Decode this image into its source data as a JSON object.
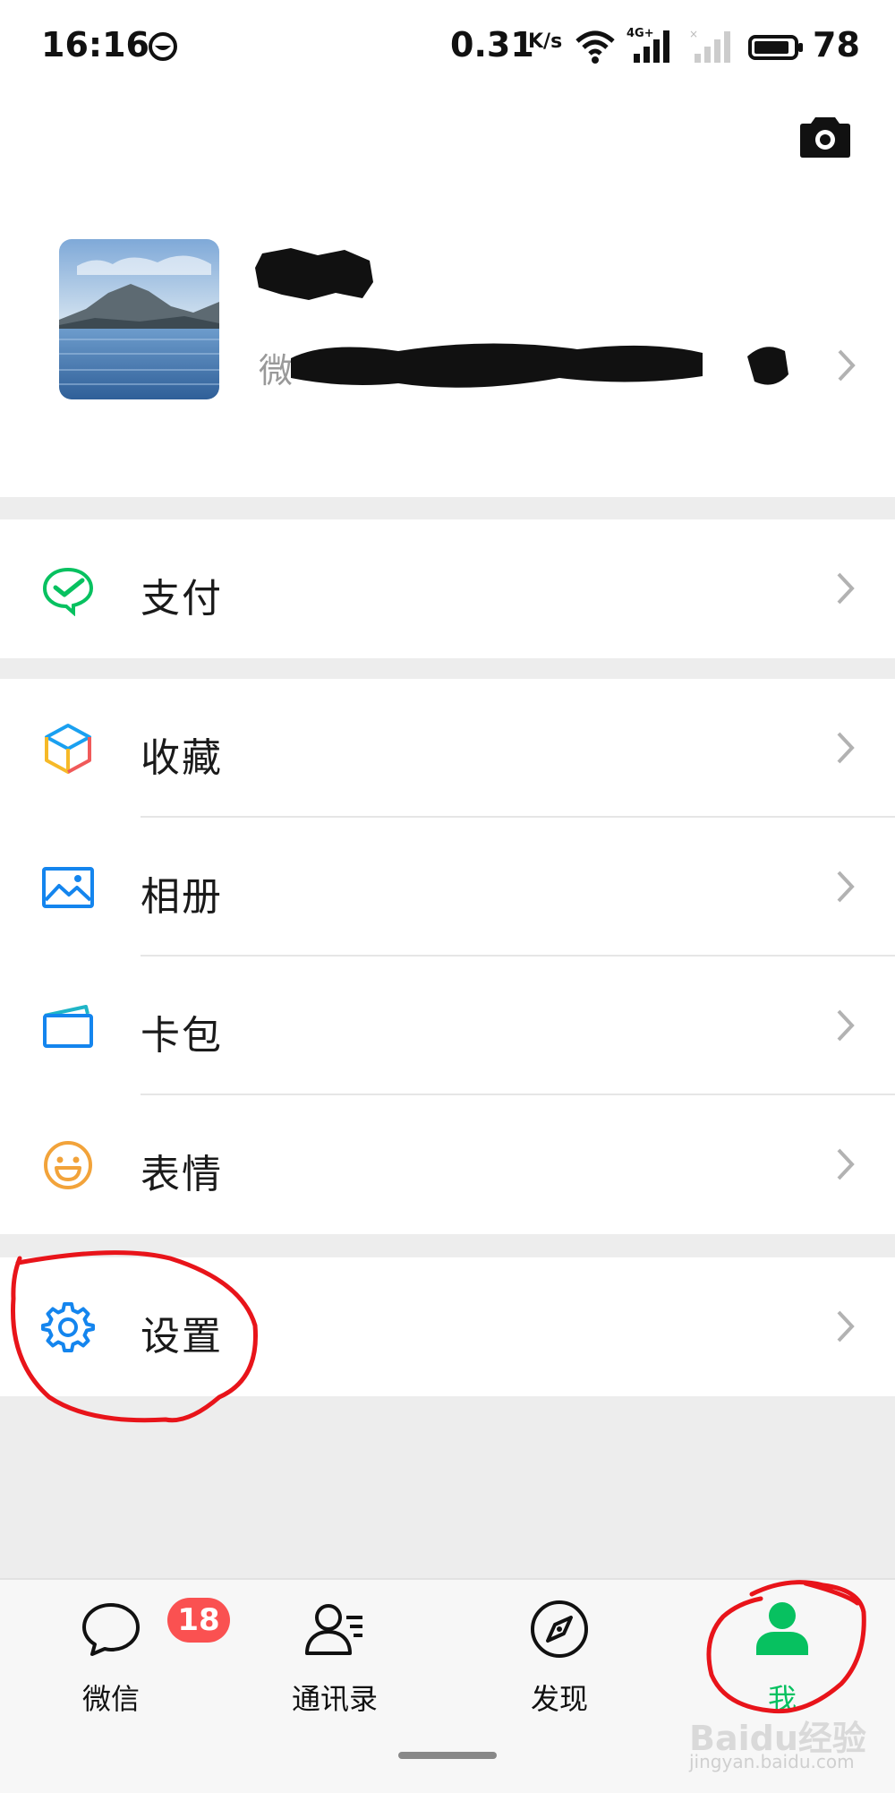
{
  "status_bar": {
    "time": "16:16",
    "net_speed": "0.31",
    "net_speed_unit": "K/s",
    "network_type": "4G+",
    "battery": "78",
    "icons": [
      "dnd-icon",
      "wifi-icon",
      "signal-icon",
      "signal-no-sim-icon",
      "battery-icon"
    ]
  },
  "profile": {
    "wechat_id_prefix": "微",
    "camera_icon": "camera-icon"
  },
  "menu": {
    "pay": {
      "label": "支付",
      "icon": "wechat-pay-icon",
      "color": "#07c160"
    },
    "favorites": {
      "label": "收藏",
      "icon": "cube-icon"
    },
    "album": {
      "label": "相册",
      "icon": "picture-icon",
      "color": "#1485ee"
    },
    "cards": {
      "label": "卡包",
      "icon": "card-wallet-icon",
      "color": "#1485ee"
    },
    "stickers": {
      "label": "表情",
      "icon": "smiley-icon",
      "color": "#f2a33a"
    },
    "settings": {
      "label": "设置",
      "icon": "gear-icon",
      "color": "#1485ee"
    }
  },
  "tabbar": {
    "tabs": [
      {
        "label": "微信",
        "icon": "chat-bubble-icon",
        "badge": "18"
      },
      {
        "label": "通讯录",
        "icon": "contacts-icon"
      },
      {
        "label": "发现",
        "icon": "compass-icon"
      },
      {
        "label": "我",
        "icon": "person-icon",
        "active": true
      }
    ],
    "active_color": "#07c160",
    "badge_color": "#fa5151"
  },
  "annotation_color": "#e8141a",
  "watermark": {
    "main": "Baidu经验",
    "sub": "jingyan.baidu.com"
  }
}
